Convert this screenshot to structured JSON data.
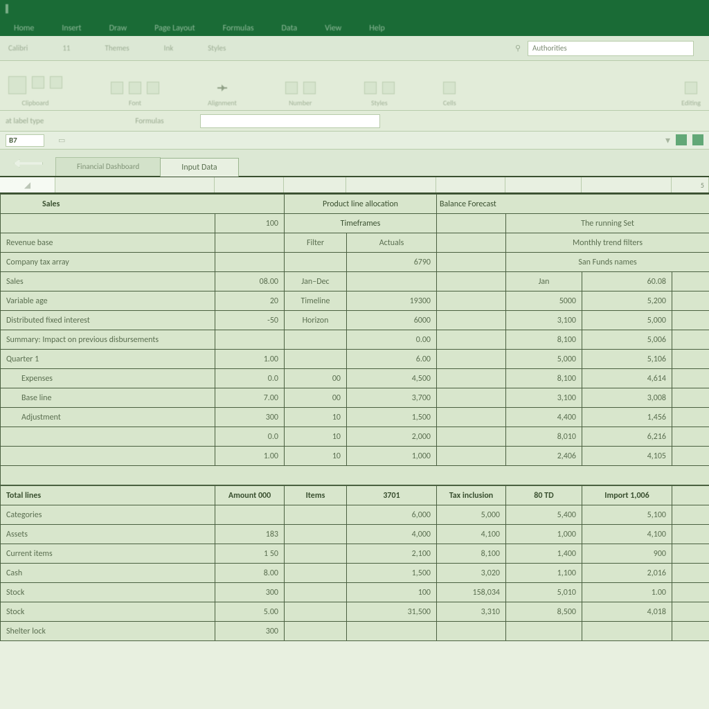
{
  "titlebar": {
    "left": "",
    "items": [
      "",
      "",
      "",
      ""
    ]
  },
  "menu": {
    "tabs": [
      "Home",
      "Insert",
      "Draw",
      "Page Layout",
      "Formulas",
      "Data",
      "View",
      "Help"
    ],
    "right": [
      "",
      "",
      ""
    ]
  },
  "sub_ribbon": {
    "groups": [
      "Calibri",
      "11",
      "Themes",
      "Ink",
      "Styles"
    ],
    "search_placeholder": "Authorities",
    "search_right": ""
  },
  "ribbon": {
    "groups": [
      "Clipboard",
      "Font",
      "Alignment",
      "Number",
      "Styles",
      "Cells",
      "Editing"
    ]
  },
  "formula_row": {
    "left": "at label  type",
    "mid": "Formulas",
    "fx": ""
  },
  "cellref": {
    "ref": "B7"
  },
  "sheet_tabs": {
    "tabs": [
      "Financial Dashboard",
      "Input Data"
    ],
    "active": 1,
    "right_num": "5"
  },
  "upper_block": {
    "title": "Sales",
    "mid_header": "Product line allocation",
    "right_header": "Balance Forecast",
    "sub1": "100",
    "sub_mid": "Timeframes",
    "right_sub1": "The running Set",
    "right_sub2": "Monthly trend filters",
    "r1": {
      "label": "Revenue base",
      "col_e": "Filter",
      "col_f": "Actuals"
    },
    "r2": {
      "label": "Company tax array",
      "col_f": "6790",
      "g_lbl": "San Funds names"
    },
    "r3": {
      "label": "Sales",
      "b": "08.00",
      "e": "Jan–Dec",
      "g_lbl": "Jan",
      "g_val": "60.08"
    },
    "r4": {
      "label": "Variable age",
      "b": "20",
      "e": "Timeline",
      "f": "19300",
      "g": "5000",
      "h": "5,200"
    },
    "r5": {
      "label": "Distributed fixed interest",
      "b": "-50",
      "e": "Horizon",
      "f": "6000",
      "g": "3,100",
      "h": "5,000"
    },
    "r6": {
      "label": "Summary: Impact on previous disbursements",
      "f": "0.00",
      "g": "8,100",
      "h": "5,006"
    },
    "r7": {
      "label": "Quarter 1",
      "b": "1.00",
      "f": "6.00",
      "g": "5,000",
      "h": "5,106"
    },
    "r8": {
      "label": "Expenses",
      "b": "0.0",
      "d": "00",
      "f": "4,500",
      "g": "8,100",
      "h": "4,614"
    },
    "r9": {
      "label": "Base line",
      "b": "7.00",
      "d": "00",
      "f": "3,700",
      "g": "3,100",
      "h": "3,008"
    },
    "r10": {
      "label": "Adjustment",
      "b": "300",
      "d": "10",
      "f": "1,500",
      "g": "4,400",
      "h": "1,456"
    },
    "r11": {
      "label": "",
      "b": "0.0",
      "d": "10",
      "f": "2,000",
      "g": "8,010",
      "h": "6,216"
    },
    "r12": {
      "label": "",
      "b": "1.00",
      "d": "10",
      "f": "1,000",
      "g": "2,406",
      "h": "4,105"
    }
  },
  "lower_block": {
    "hdr": {
      "a": "Total lines",
      "b": "Amount 000",
      "c": "Items",
      "d": "3701",
      "e": "Tax inclusion",
      "g": "80 TD",
      "h": "Import 1,006"
    },
    "rows": [
      {
        "a": "Categories",
        "b": "",
        "d": "6,000",
        "e": "5,000",
        "g": "5,400",
        "h": "5,100"
      },
      {
        "a": "Assets",
        "b": "183",
        "d": "4,000",
        "e": "4,100",
        "g": "1,000",
        "h": "4,100"
      },
      {
        "a": "Current items",
        "b": "1 50",
        "d": "2,100",
        "e": "8,100",
        "g": "1,400",
        "h": "900"
      },
      {
        "a": "Cash",
        "b": "8.00",
        "d": "1,500",
        "e": "3,020",
        "g": "1,100",
        "h": "2,016"
      },
      {
        "a": "Stock",
        "b": "300",
        "d": "100",
        "e": "158,034",
        "g": "5,010",
        "h": "1.00"
      },
      {
        "a": "Stock",
        "b": "5.00",
        "d": "31,500",
        "e": "3,310",
        "g": "8,500",
        "h": "4,018"
      },
      {
        "a": "Shelter lock",
        "b": "300",
        "d": "",
        "e": "",
        "g": "",
        "h": ""
      }
    ]
  }
}
